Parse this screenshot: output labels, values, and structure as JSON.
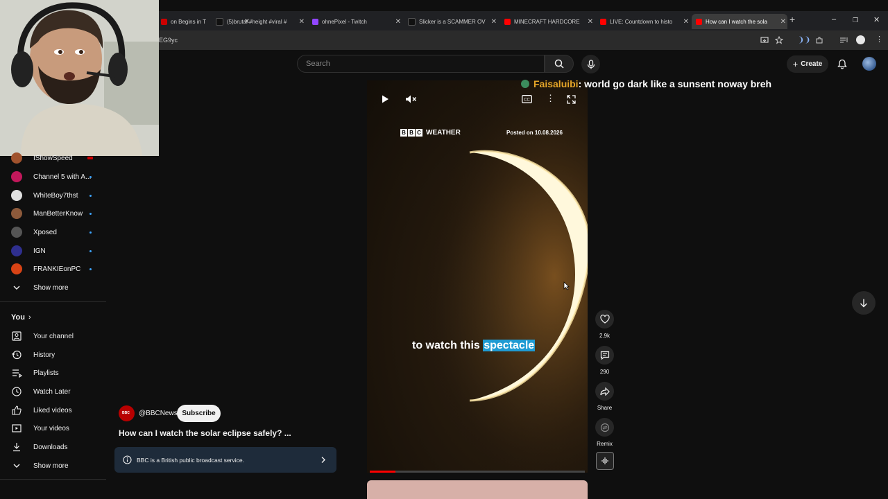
{
  "browser": {
    "tabs": [
      {
        "label": "on Begins in T",
        "icon": "youtube-icon",
        "color": "#cc0000"
      },
      {
        "label": "(5)brutal #height #viral #",
        "icon": "tiktok-icon",
        "color": "#111111"
      },
      {
        "label": "ohnePixel - Twitch",
        "icon": "twitch-icon",
        "color": "#9146ff"
      },
      {
        "label": "Slicker is a SCAMMER OV",
        "icon": "tiktok-icon",
        "color": "#111111"
      },
      {
        "label": "MINECRAFT HARDCORE",
        "icon": "youtube-icon",
        "color": "#ff0000"
      },
      {
        "label": "LIVE: Countdown to histo",
        "icon": "youtube-icon",
        "color": "#ff0000"
      },
      {
        "label": "How can I watch the sola",
        "icon": "youtube-icon",
        "color": "#ff0000"
      }
    ],
    "url_fragment": "EG9yc"
  },
  "header": {
    "search_placeholder": "Search",
    "create_label": "Create"
  },
  "sidebar": {
    "subscriptions": [
      {
        "label": "IShowSpeed",
        "color": "#a0522d",
        "indicator": "live"
      },
      {
        "label": "Channel 5 with A...",
        "color": "#c2185b",
        "indicator": "dot"
      },
      {
        "label": "WhiteBoy7thst",
        "color": "#eeeeee",
        "indicator": "dot"
      },
      {
        "label": "ManBetterKnow",
        "color": "#8d5a3b",
        "indicator": "dot"
      },
      {
        "label": "Xposed",
        "color": "#555555",
        "indicator": "dot"
      },
      {
        "label": "IGN",
        "color": "#2f2f8f",
        "indicator": "dot"
      },
      {
        "label": "FRANKIEonPC",
        "color": "#d84315",
        "indicator": "dot"
      }
    ],
    "show_more_1": "Show more",
    "you_label": "You",
    "you_items": [
      {
        "label": "Your channel",
        "icon": "your-channel-icon"
      },
      {
        "label": "History",
        "icon": "history-icon"
      },
      {
        "label": "Playlists",
        "icon": "playlists-icon"
      },
      {
        "label": "Watch Later",
        "icon": "watch-later-icon"
      },
      {
        "label": "Liked videos",
        "icon": "like-icon"
      },
      {
        "label": "Your videos",
        "icon": "your-videos-icon"
      },
      {
        "label": "Downloads",
        "icon": "download-icon"
      }
    ],
    "show_more_2": "Show more"
  },
  "video": {
    "brand": "WEATHER",
    "bbc_letters": [
      "B",
      "B",
      "C"
    ],
    "posted": "Posted on 10.08.2026",
    "caption_before": "to watch this ",
    "caption_highlight": "spectacle",
    "progress_fraction": 0.12
  },
  "actions": {
    "likes": "2.9k",
    "comments": "290",
    "share": "Share",
    "remix": "Remix"
  },
  "chat": {
    "name": "Faisaluibi",
    "message": ": world go dark like a sunsent noway breh"
  },
  "channel": {
    "handle": "@BBCNews",
    "subscribe_label": "Subscribe",
    "video_title": "How can I watch the solar eclipse safely? ...",
    "info_text": "BBC is a British public broadcast service."
  },
  "colors": {
    "accent_red": "#ff0000",
    "caption_highlight": "#1f9bd3",
    "chat_name": "#e6a628",
    "info_bar": "#1e2b3a"
  }
}
